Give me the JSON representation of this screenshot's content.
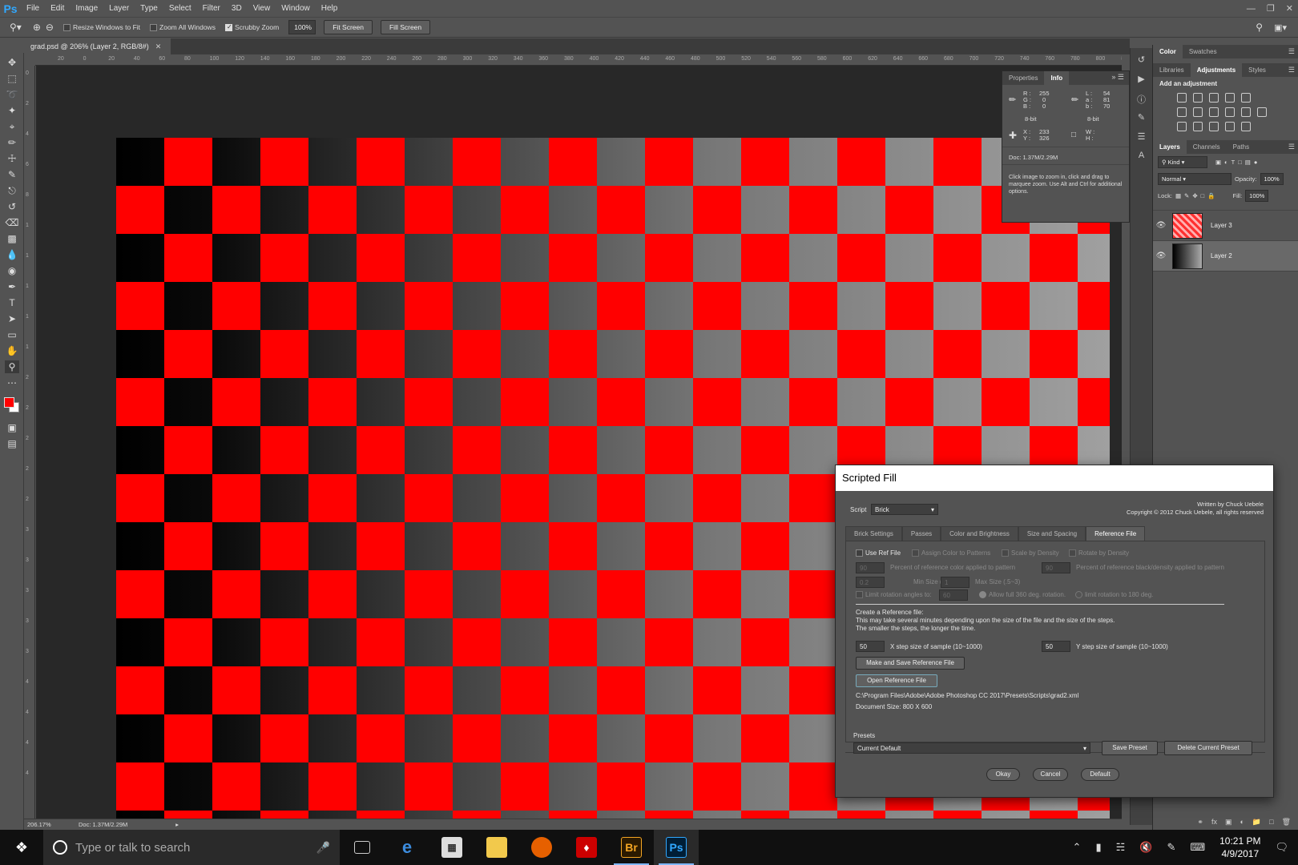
{
  "app": {
    "logo": "Ps"
  },
  "menu": [
    "File",
    "Edit",
    "Image",
    "Layer",
    "Type",
    "Select",
    "Filter",
    "3D",
    "View",
    "Window",
    "Help"
  ],
  "options": {
    "resize_windows": "Resize Windows to Fit",
    "zoom_all": "Zoom All Windows",
    "scrubby_zoom": "Scrubby Zoom",
    "zoom_level": "100%",
    "fit_screen": "Fit Screen",
    "fill_screen": "Fill Screen"
  },
  "document": {
    "tab_title": "grad.psd @ 206% (Layer 2, RGB/8#)"
  },
  "ruler_h_ticks": [
    "20",
    "0",
    "20",
    "40",
    "60",
    "80",
    "100",
    "120",
    "140",
    "160",
    "180",
    "200",
    "220",
    "240",
    "260",
    "280",
    "300",
    "320",
    "340",
    "360",
    "380",
    "400",
    "420",
    "440",
    "460",
    "480",
    "500",
    "520",
    "540",
    "560",
    "580",
    "600",
    "620",
    "640",
    "660",
    "680",
    "700",
    "720",
    "740",
    "760",
    "780",
    "800",
    "820"
  ],
  "ruler_v_ticks": [
    "0",
    "2",
    "4",
    "6",
    "8",
    "1",
    "1",
    "1",
    "1",
    "1",
    "2",
    "2",
    "2",
    "2",
    "2",
    "3",
    "3",
    "3",
    "3",
    "3",
    "4",
    "4",
    "4",
    "4"
  ],
  "status": {
    "zoom": "206.17%",
    "doc": "Doc: 1.37M/2.29M"
  },
  "info_panel": {
    "tabs": [
      "Properties",
      "Info"
    ],
    "rgb": {
      "r_label": "R :",
      "r": "255",
      "g_label": "G :",
      "g": "0",
      "b_label": "B :",
      "b": "0"
    },
    "lab": {
      "l_label": "L :",
      "l": "54",
      "a_label": "a :",
      "a": "81",
      "b_label": "b :",
      "b": "70"
    },
    "bit_left": "8-bit",
    "bit_right": "8-bit",
    "x_label": "X :",
    "x": "233",
    "y_label": "Y :",
    "y": "326",
    "w_label": "W :",
    "h_label": "H :",
    "doc": "Doc: 1.37M/2.29M",
    "hint": "Click image to zoom in, click and drag to marquee zoom.  Use Alt and Ctrl for additional options."
  },
  "dock": {
    "color_tabs": [
      "Color",
      "Swatches"
    ],
    "adj_tabs": [
      "Libraries",
      "Adjustments",
      "Styles"
    ],
    "add_adjustment": "Add an adjustment",
    "layer_tabs": [
      "Layers",
      "Channels",
      "Paths"
    ],
    "kind": "Kind",
    "blend_mode": "Normal",
    "opacity_label": "Opacity:",
    "opacity": "100%",
    "lock_label": "Lock:",
    "fill_label": "Fill:",
    "fill": "100%",
    "layers": [
      {
        "name": "Layer 3"
      },
      {
        "name": "Layer 2"
      }
    ]
  },
  "dialog": {
    "title": "Scripted Fill",
    "script_label": "Script",
    "script_value": "Brick",
    "written_by": "Written by Chuck Uebele",
    "copyright": "Copyright © 2012 Chuck Uebele, all rights reserved",
    "tabs": [
      "Brick Settings",
      "Passes",
      "Color and Brightness",
      "Size and Spacing",
      "Reference File"
    ],
    "active_tab": "Reference File",
    "use_ref_file": "Use Ref File",
    "assign_color": "Assign Color to Patterns",
    "scale_by_density": "Scale by Density",
    "rotate_by_density": "Rotate by Density",
    "pct_ref_color_val": "90",
    "pct_ref_color": "Percent of reference color applied to pattern",
    "pct_ref_black_val": "90",
    "pct_ref_black": "Percent of reference black/density applied to pattern",
    "min_size_val": "0.2",
    "min_size": "Min Size (.1~1)",
    "max_size_val": "1",
    "max_size": "Max Size (.5~3)",
    "limit_rot": "Limit rotation angles to:",
    "limit_rot_val": "60",
    "allow_full": "Allow full 360 deg. rotation.",
    "limit_180": "limit rotation to 180 deg.",
    "create_ref_title": "Create a Reference file:",
    "create_ref_desc1": "This may take several minutes depending upon the size of the file and the size of the steps.",
    "create_ref_desc2": "The smaller the steps, the longer the time.",
    "x_step_val": "50",
    "x_step": "X step size of sample (10~1000)",
    "y_step_val": "50",
    "y_step": "Y step size of sample (10~1000)",
    "make_save": "Make and Save Reference File",
    "open_ref": "Open Reference File",
    "ref_path": "C:\\Program Files\\Adobe\\Adobe Photoshop CC 2017\\Presets\\Scripts\\grad2.xml",
    "doc_size": "Document Size: 800 X 600",
    "presets_label": "Presets",
    "preset_value": "Current Default",
    "save_preset": "Save Preset",
    "delete_preset": "Delete Current Preset",
    "okay": "Okay",
    "cancel": "Cancel",
    "default": "Default"
  },
  "taskbar": {
    "search_placeholder": "Type or talk to search",
    "bridge_label": "Br",
    "ps_label": "Ps",
    "time": "10:21 PM",
    "date": "4/9/2017"
  },
  "colors": {
    "foreground": "#ff0000",
    "background": "#ffffff",
    "ps_blue": "#31a8ff"
  }
}
